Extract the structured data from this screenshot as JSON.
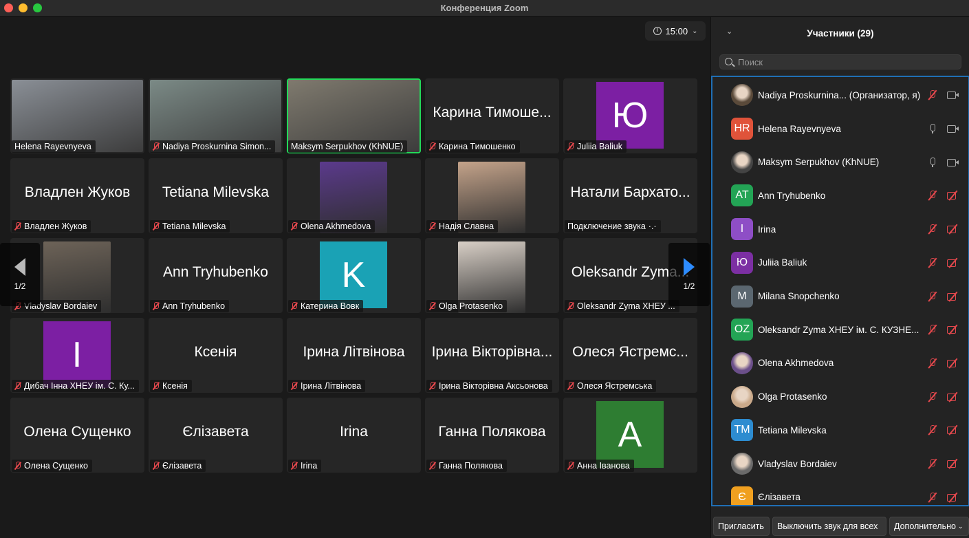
{
  "window": {
    "title": "Конференция Zoom"
  },
  "timer": {
    "time": "15:00"
  },
  "pager": {
    "left": "1/2",
    "right": "1/2"
  },
  "tiles": [
    {
      "name": "Helena Rayevnyeva",
      "big": "",
      "type": "photo",
      "muted": false
    },
    {
      "name": "Nadiya Proskurnina Simon...",
      "big": "",
      "type": "photo",
      "muted": true
    },
    {
      "name": "Maksym Serpukhov (KhNUE)",
      "big": "",
      "type": "photo",
      "muted": false,
      "active": true
    },
    {
      "name": "Карина Тимошенко",
      "big": "Карина Тимоше...",
      "type": "text",
      "muted": true
    },
    {
      "name": "Juliia Baliuk",
      "big": "",
      "type": "avatar",
      "letter": "Ю",
      "color": "#7c1fa3",
      "muted": true
    },
    {
      "name": "Владлен Жуков",
      "big": "Владлен Жуков",
      "type": "text",
      "muted": true
    },
    {
      "name": "Tetiana Milevska",
      "big": "Tetiana Milevska",
      "type": "text",
      "muted": true
    },
    {
      "name": "Olena Akhmedova",
      "big": "",
      "type": "photo-sq",
      "muted": true
    },
    {
      "name": "Надія Славна",
      "big": "",
      "type": "photo-sq",
      "muted": true
    },
    {
      "name": "Подключение звука",
      "big": "Натали Бархато...",
      "type": "text",
      "muted": false,
      "connecting": true
    },
    {
      "name": "Vladyslav Bordaiev",
      "big": "",
      "type": "photo-sq",
      "muted": true
    },
    {
      "name": "Ann Tryhubenko",
      "big": "Ann Tryhubenko",
      "type": "text",
      "muted": true
    },
    {
      "name": "Катерина Вовк",
      "big": "",
      "type": "avatar",
      "letter": "K",
      "color": "#1aa2b5",
      "muted": true
    },
    {
      "name": "Olga Protasenko",
      "big": "",
      "type": "photo-sq",
      "muted": true
    },
    {
      "name": "Oleksandr Zyma ХНЕУ ...",
      "big": "Oleksandr Zyma...",
      "type": "text",
      "muted": true
    },
    {
      "name": "Дибач Інна ХНЕУ ім. С. Ку...",
      "big": "",
      "type": "avatar",
      "letter": "I",
      "color": "#7c1fa3",
      "muted": true
    },
    {
      "name": "Ксенія",
      "big": "Ксенія",
      "type": "text",
      "muted": true
    },
    {
      "name": "Ірина Літвінова",
      "big": "Ірина Літвінова",
      "type": "text",
      "muted": true
    },
    {
      "name": "Ірина Вікторівна Аксьонова",
      "big": "Ірина Вікторівна...",
      "type": "text",
      "muted": true
    },
    {
      "name": "Олеся Ястремська",
      "big": "Олеся Ястремс...",
      "type": "text",
      "muted": true
    },
    {
      "name": "Олена Сущенко",
      "big": "Олена Сущенко",
      "type": "text",
      "muted": true
    },
    {
      "name": "Єлізавета",
      "big": "Єлізавета",
      "type": "text",
      "muted": true
    },
    {
      "name": "Irina",
      "big": "Irina",
      "type": "text",
      "muted": true
    },
    {
      "name": "Ганна Полякова",
      "big": "Ганна Полякова",
      "type": "text",
      "muted": true
    },
    {
      "name": "Анна Іванова",
      "big": "",
      "type": "avatar",
      "letter": "A",
      "color": "#2e7d32",
      "muted": true
    }
  ],
  "panel": {
    "title": "Участники (29)",
    "search_placeholder": "Поиск",
    "participants": [
      {
        "name": "Nadiya Proskurnina...  (Организатор, я)",
        "initials": "",
        "color": "#5a4a3a",
        "photo": true,
        "mic": "off",
        "cam": "on"
      },
      {
        "name": "Helena Rayevnyeva",
        "initials": "HR",
        "color": "#e0533a",
        "photo": false,
        "mic": "on",
        "cam": "on"
      },
      {
        "name": "Maksym Serpukhov (KhNUE)",
        "initials": "",
        "color": "#444",
        "photo": true,
        "mic": "on",
        "cam": "on"
      },
      {
        "name": "Ann Tryhubenko",
        "initials": "AT",
        "color": "#23a455",
        "photo": false,
        "mic": "off",
        "cam": "off"
      },
      {
        "name": "Irina",
        "initials": "I",
        "color": "#8e4ec6",
        "photo": false,
        "mic": "off",
        "cam": "off"
      },
      {
        "name": "Juliia Baliuk",
        "initials": "Ю",
        "color": "#7c2fa3",
        "photo": false,
        "mic": "off",
        "cam": "off"
      },
      {
        "name": "Milana Snopchenko",
        "initials": "M",
        "color": "#5b6770",
        "photo": false,
        "mic": "off",
        "cam": "off"
      },
      {
        "name": "Oleksandr Zyma ХНЕУ ім. С. КУЗНЕ...",
        "initials": "OZ",
        "color": "#23a455",
        "photo": false,
        "mic": "off",
        "cam": "off"
      },
      {
        "name": "Olena Akhmedova",
        "initials": "",
        "color": "#6b4f8a",
        "photo": true,
        "mic": "off",
        "cam": "off"
      },
      {
        "name": "Olga Protasenko",
        "initials": "",
        "color": "#c9a98a",
        "photo": true,
        "mic": "off",
        "cam": "off"
      },
      {
        "name": "Tetiana Milevska",
        "initials": "TM",
        "color": "#2d8cd0",
        "photo": false,
        "mic": "off",
        "cam": "off"
      },
      {
        "name": "Vladyslav Bordaiev",
        "initials": "",
        "color": "#6a6a6a",
        "photo": true,
        "mic": "off",
        "cam": "off"
      },
      {
        "name": "Єлізавета",
        "initials": "Є",
        "color": "#f0a020",
        "photo": false,
        "mic": "off",
        "cam": "off"
      }
    ],
    "buttons": {
      "invite": "Пригласить",
      "mute_all": "Выключить звук для всех",
      "more": "Дополнительно"
    }
  }
}
